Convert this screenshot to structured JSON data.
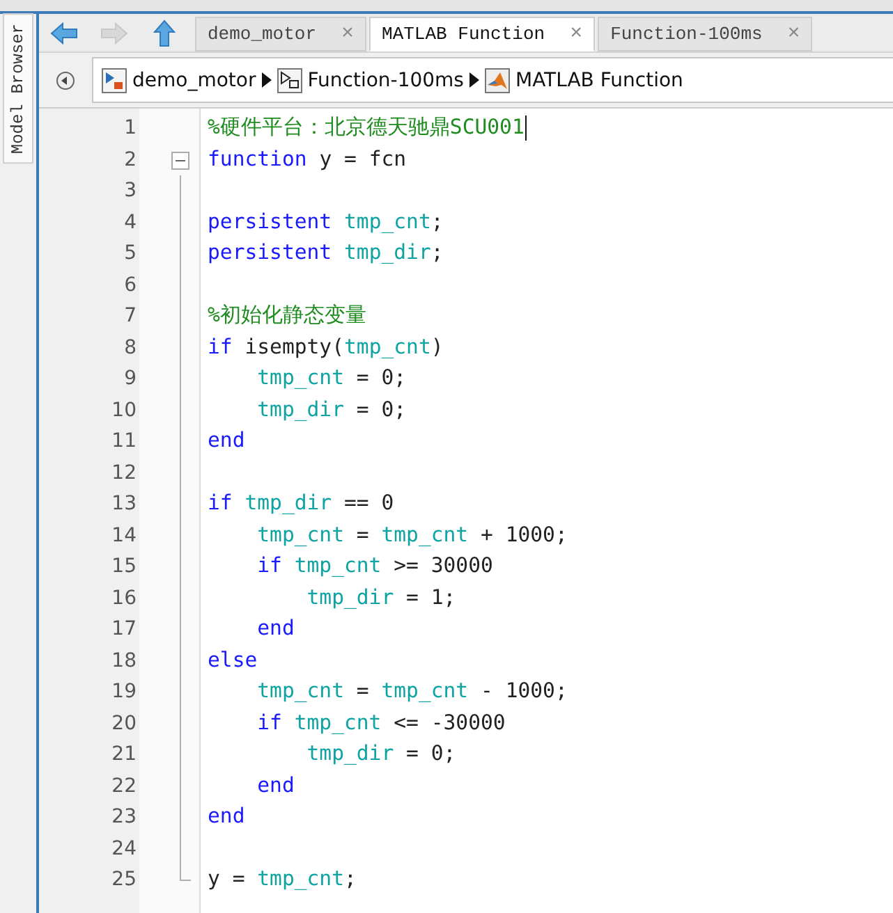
{
  "side_tab": {
    "label": "Model Browser"
  },
  "nav": {
    "back": {
      "disabled": false
    },
    "forward": {
      "disabled": true
    },
    "up": {
      "disabled": false
    }
  },
  "tabs": [
    {
      "label": "demo_motor",
      "selected": false,
      "close": "×"
    },
    {
      "label": "MATLAB Function",
      "selected": true,
      "close": "×"
    },
    {
      "label": "Function-100ms",
      "selected": false,
      "close": "×"
    }
  ],
  "breadcrumb": [
    {
      "label": "demo_motor",
      "kind": "model"
    },
    {
      "label": "Function-100ms",
      "kind": "subsystem"
    },
    {
      "label": "MATLAB Function",
      "kind": "function"
    }
  ],
  "editor": {
    "fold": {
      "expanded": true
    },
    "lines": [
      {
        "number": "1",
        "cursor": true,
        "tokens": [
          {
            "kind": "comment",
            "text": "%硬件平台：北京德天驰鼎SCU001"
          }
        ]
      },
      {
        "number": "2",
        "cursor": false,
        "tokens": [
          {
            "kind": "keyword",
            "text": "function"
          },
          {
            "kind": "plain",
            "text": " y = fcn"
          }
        ]
      },
      {
        "number": "3",
        "cursor": false
      },
      {
        "number": "4",
        "cursor": false,
        "tokens": [
          {
            "kind": "keyword",
            "text": "persistent"
          },
          {
            "kind": "variable",
            "text": " tmp_cnt"
          },
          {
            "kind": "plain",
            "text": ";"
          }
        ]
      },
      {
        "number": "5",
        "cursor": false,
        "tokens": [
          {
            "kind": "keyword",
            "text": "persistent"
          },
          {
            "kind": "variable",
            "text": " tmp_dir"
          },
          {
            "kind": "plain",
            "text": ";"
          }
        ]
      },
      {
        "number": "6",
        "cursor": false
      },
      {
        "number": "7",
        "cursor": false,
        "tokens": [
          {
            "kind": "comment",
            "text": "%初始化静态变量"
          }
        ]
      },
      {
        "number": "8",
        "cursor": false,
        "tokens": [
          {
            "kind": "keyword",
            "text": "if"
          },
          {
            "kind": "plain",
            "text": " isempty("
          },
          {
            "kind": "variable",
            "text": "tmp_cnt"
          },
          {
            "kind": "plain",
            "text": ")"
          }
        ]
      },
      {
        "number": "9",
        "cursor": false,
        "tokens": [
          {
            "kind": "variable",
            "text": "    tmp_cnt"
          },
          {
            "kind": "plain",
            "text": " = 0;"
          }
        ]
      },
      {
        "number": "10",
        "cursor": false,
        "tokens": [
          {
            "kind": "variable",
            "text": "    tmp_dir"
          },
          {
            "kind": "plain",
            "text": " = 0;"
          }
        ]
      },
      {
        "number": "11",
        "cursor": false,
        "tokens": [
          {
            "kind": "keyword",
            "text": "end"
          }
        ]
      },
      {
        "number": "12",
        "cursor": false
      },
      {
        "number": "13",
        "cursor": false,
        "tokens": [
          {
            "kind": "keyword",
            "text": "if"
          },
          {
            "kind": "variable",
            "text": " tmp_dir"
          },
          {
            "kind": "plain",
            "text": " == 0"
          }
        ]
      },
      {
        "number": "14",
        "cursor": false,
        "tokens": [
          {
            "kind": "variable",
            "text": "    tmp_cnt"
          },
          {
            "kind": "plain",
            "text": " = "
          },
          {
            "kind": "variable",
            "text": "tmp_cnt"
          },
          {
            "kind": "plain",
            "text": " + 1000;"
          }
        ]
      },
      {
        "number": "15",
        "cursor": false,
        "tokens": [
          {
            "kind": "keyword",
            "text": "    if"
          },
          {
            "kind": "variable",
            "text": " tmp_cnt"
          },
          {
            "kind": "plain",
            "text": " >= 30000"
          }
        ]
      },
      {
        "number": "16",
        "cursor": false,
        "tokens": [
          {
            "kind": "variable",
            "text": "        tmp_dir"
          },
          {
            "kind": "plain",
            "text": " = 1;"
          }
        ]
      },
      {
        "number": "17",
        "cursor": false,
        "tokens": [
          {
            "kind": "keyword",
            "text": "    end"
          }
        ]
      },
      {
        "number": "18",
        "cursor": false,
        "tokens": [
          {
            "kind": "keyword",
            "text": "else"
          }
        ]
      },
      {
        "number": "19",
        "cursor": false,
        "tokens": [
          {
            "kind": "variable",
            "text": "    tmp_cnt"
          },
          {
            "kind": "plain",
            "text": " = "
          },
          {
            "kind": "variable",
            "text": "tmp_cnt"
          },
          {
            "kind": "plain",
            "text": " - 1000;"
          }
        ]
      },
      {
        "number": "20",
        "cursor": false,
        "tokens": [
          {
            "kind": "keyword",
            "text": "    if"
          },
          {
            "kind": "variable",
            "text": " tmp_cnt"
          },
          {
            "kind": "plain",
            "text": " <= -30000"
          }
        ]
      },
      {
        "number": "21",
        "cursor": false,
        "tokens": [
          {
            "kind": "variable",
            "text": "        tmp_dir"
          },
          {
            "kind": "plain",
            "text": " = 0;"
          }
        ]
      },
      {
        "number": "22",
        "cursor": false,
        "tokens": [
          {
            "kind": "keyword",
            "text": "    end"
          }
        ]
      },
      {
        "number": "23",
        "cursor": false,
        "tokens": [
          {
            "kind": "keyword",
            "text": "end"
          }
        ]
      },
      {
        "number": "24",
        "cursor": false
      },
      {
        "number": "25",
        "cursor": false,
        "tokens": [
          {
            "kind": "plain",
            "text": "y = "
          },
          {
            "kind": "variable",
            "text": "tmp_cnt"
          },
          {
            "kind": "plain",
            "text": ";"
          }
        ]
      }
    ]
  }
}
